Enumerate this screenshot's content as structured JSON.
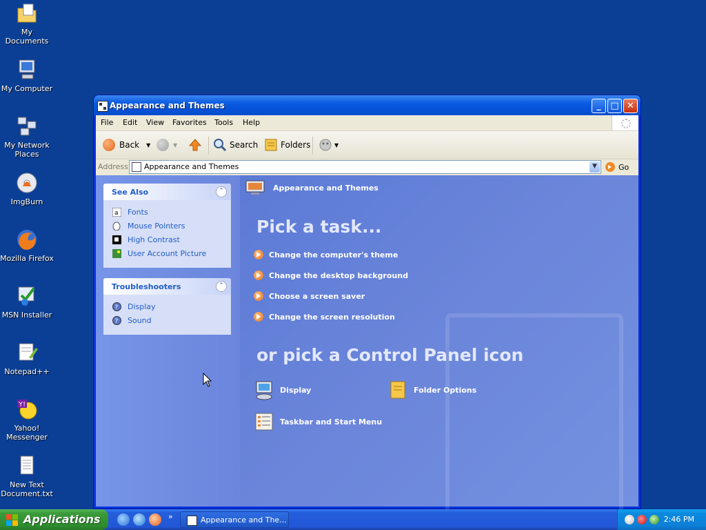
{
  "desktop": {
    "icons": [
      {
        "label": "My Documents",
        "icon": "folder-icon"
      },
      {
        "label": "My Computer",
        "icon": "computer-icon"
      },
      {
        "label": "My Network Places",
        "icon": "network-icon"
      },
      {
        "label": "ImgBurn",
        "icon": "disc-burn-icon"
      },
      {
        "label": "Mozilla Firefox",
        "icon": "firefox-icon"
      },
      {
        "label": "MSN Installer",
        "icon": "installer-icon"
      },
      {
        "label": "Notepad++",
        "icon": "notepad-icon"
      },
      {
        "label": "Yahoo! Messenger",
        "icon": "yahoo-messenger-icon"
      },
      {
        "label": "New Text Document.txt",
        "icon": "text-document-icon"
      }
    ]
  },
  "window": {
    "title": "Appearance and Themes",
    "menu": [
      "File",
      "Edit",
      "View",
      "Favorites",
      "Tools",
      "Help"
    ],
    "toolbar": {
      "back": "Back",
      "search": "Search",
      "folders": "Folders"
    },
    "address": {
      "label": "Address",
      "value": "Appearance and Themes",
      "go": "Go"
    },
    "see_also": {
      "title": "See Also",
      "items": [
        "Fonts",
        "Mouse Pointers",
        "High Contrast",
        "User Account Picture"
      ]
    },
    "troubleshooters": {
      "title": "Troubleshooters",
      "items": [
        "Display",
        "Sound"
      ]
    },
    "main": {
      "breadcrumb": "Appearance and Themes",
      "pick_task": "Pick a task...",
      "tasks": [
        "Change the computer's theme",
        "Change the desktop background",
        "Choose a screen saver",
        "Change the screen resolution"
      ],
      "pick_icon": "or pick a Control Panel icon",
      "icons": [
        "Display",
        "Folder Options",
        "Taskbar and Start Menu"
      ]
    }
  },
  "taskbar": {
    "start": "Applications",
    "task": "Appearance and The...",
    "clock": "2:46 PM",
    "quicklaunch_more": "»"
  },
  "colors": {
    "desktop": "#0b3f96",
    "title_blue": "#0a5be0",
    "panel_link": "#215dc6",
    "start_green": "#3a9a3a"
  }
}
